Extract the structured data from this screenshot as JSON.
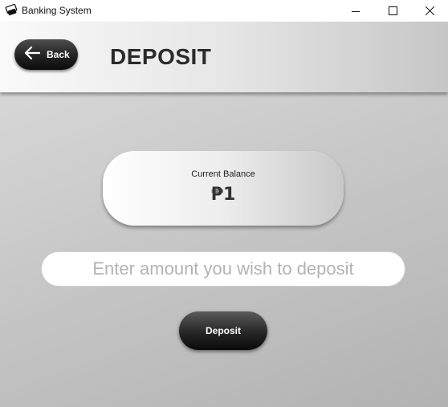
{
  "window": {
    "title": "Banking System",
    "icon": "bank-app-icon",
    "controls": [
      "minimize-icon",
      "maximize-icon",
      "close-icon"
    ]
  },
  "header": {
    "back_label": "Back",
    "back_icon": "arrow-left-icon",
    "title": "DEPOSIT"
  },
  "balance": {
    "label": "Current Balance",
    "value": "₱1"
  },
  "amount_input": {
    "value": "",
    "placeholder": "Enter amount you wish to deposit"
  },
  "deposit_button": {
    "label": "Deposit"
  },
  "colors": {
    "button_dark": "#1a1a1a",
    "title_text": "#2a2a2a",
    "placeholder_text": "#b3b3b3"
  }
}
